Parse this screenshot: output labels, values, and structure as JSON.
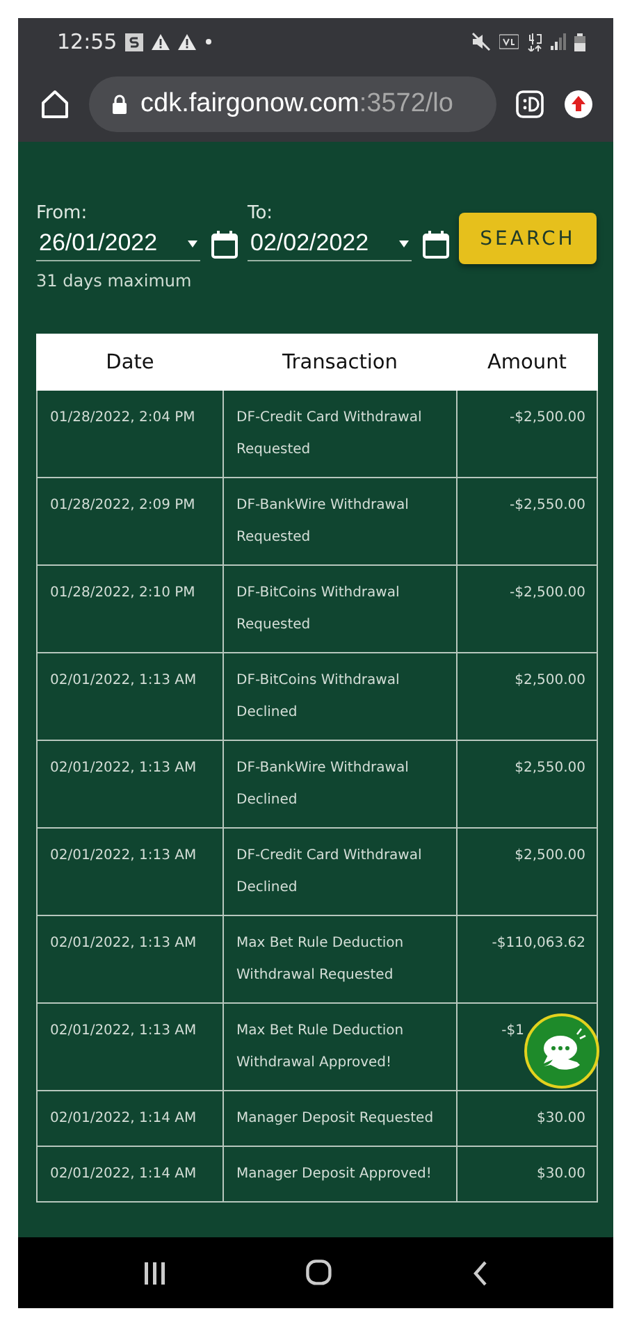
{
  "status_bar": {
    "time": "12:55"
  },
  "url_bar": {
    "host": "cdk.fairgonow.com",
    "path": ":3572/lo"
  },
  "filter": {
    "from": {
      "label": "From:",
      "value": "26/01/2022"
    },
    "to": {
      "label": "To:",
      "value": "02/02/2022"
    },
    "button": "SEARCH",
    "hint": "31 days maximum"
  },
  "table": {
    "columns": [
      "Date",
      "Transaction",
      "Amount"
    ],
    "rows": [
      {
        "date": "01/28/2022, 2:04 PM",
        "transaction": "DF-Credit Card Withdrawal Requested",
        "amount": "-$2,500.00"
      },
      {
        "date": "01/28/2022, 2:09 PM",
        "transaction": "DF-BankWire Withdrawal Requested",
        "amount": "-$2,550.00"
      },
      {
        "date": "01/28/2022, 2:10 PM",
        "transaction": "DF-BitCoins Withdrawal Requested",
        "amount": "-$2,500.00"
      },
      {
        "date": "02/01/2022, 1:13 AM",
        "transaction": "DF-BitCoins Withdrawal Declined",
        "amount": "$2,500.00"
      },
      {
        "date": "02/01/2022, 1:13 AM",
        "transaction": "DF-BankWire Withdrawal Declined",
        "amount": "$2,550.00"
      },
      {
        "date": "02/01/2022, 1:13 AM",
        "transaction": "DF-Credit Card Withdrawal Declined",
        "amount": "$2,500.00"
      },
      {
        "date": "02/01/2022, 1:13 AM",
        "transaction": "Max Bet Rule Deduction Withdrawal Requested",
        "amount": "-$110,063.62"
      },
      {
        "date": "02/01/2022, 1:13 AM",
        "transaction": "Max Bet Rule Deduction Withdrawal Approved!",
        "amount": "-$1",
        "obscured": true
      },
      {
        "date": "02/01/2022, 1:14 AM",
        "transaction": "Manager Deposit Requested",
        "amount": "$30.00"
      },
      {
        "date": "02/01/2022, 1:14 AM",
        "transaction": "Manager Deposit Approved!",
        "amount": "$30.00"
      }
    ]
  }
}
